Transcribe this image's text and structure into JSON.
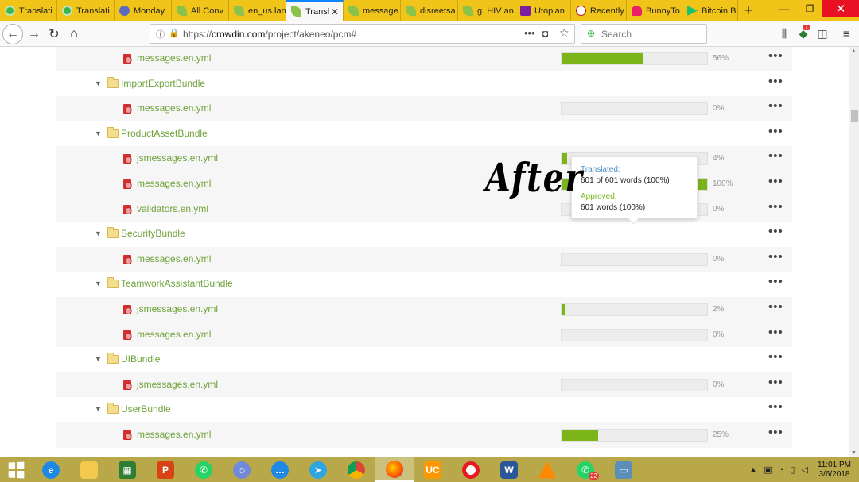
{
  "tabs": [
    {
      "label": "Translati",
      "icon": "crowdin",
      "active": false
    },
    {
      "label": "Translati",
      "icon": "crowdin",
      "active": false
    },
    {
      "label": "Monday",
      "icon": "monday",
      "active": false
    },
    {
      "label": "All Conv",
      "icon": "leaf",
      "active": false
    },
    {
      "label": "en_us.lan",
      "icon": "leaf",
      "active": false
    },
    {
      "label": "Transl",
      "icon": "leaf",
      "active": true
    },
    {
      "label": "message",
      "icon": "leaf",
      "active": false
    },
    {
      "label": "disreetsa",
      "icon": "leaf",
      "active": false
    },
    {
      "label": "g. HIV an",
      "icon": "leaf",
      "active": false
    },
    {
      "label": "Utopian",
      "icon": "utopian",
      "active": false
    },
    {
      "label": "Recently",
      "icon": "recently",
      "active": false
    },
    {
      "label": "BunnyTo",
      "icon": "bunny",
      "active": false
    },
    {
      "label": "Bitcoin B",
      "icon": "bitcoin",
      "active": false
    }
  ],
  "nav": {
    "url_prefix": "https://",
    "url_host": "crowdin.com",
    "url_path": "/project/akeneo/pcm#",
    "search_placeholder": "Search",
    "notification_count": "7"
  },
  "rows": [
    {
      "type": "file",
      "name": "messages.en.yml",
      "progress": 56,
      "pct": "56%"
    },
    {
      "type": "folder",
      "name": "ImportExportBundle"
    },
    {
      "type": "file",
      "name": "messages.en.yml",
      "progress": 0,
      "pct": "0%"
    },
    {
      "type": "folder",
      "name": "ProductAssetBundle"
    },
    {
      "type": "file",
      "name": "jsmessages.en.yml",
      "progress": 4,
      "pct": "4%"
    },
    {
      "type": "file",
      "name": "messages.en.yml",
      "progress": 100,
      "pct": "100%"
    },
    {
      "type": "file",
      "name": "validators.en.yml",
      "progress": 0,
      "pct": "0%"
    },
    {
      "type": "folder",
      "name": "SecurityBundle"
    },
    {
      "type": "file",
      "name": "messages.en.yml",
      "progress": 0,
      "pct": "0%"
    },
    {
      "type": "folder",
      "name": "TeamworkAssistantBundle"
    },
    {
      "type": "file",
      "name": "jsmessages.en.yml",
      "progress": 2,
      "pct": "2%"
    },
    {
      "type": "file",
      "name": "messages.en.yml",
      "progress": 0,
      "pct": "0%"
    },
    {
      "type": "folder",
      "name": "UIBundle"
    },
    {
      "type": "file",
      "name": "jsmessages.en.yml",
      "progress": 0,
      "pct": "0%"
    },
    {
      "type": "folder",
      "name": "UserBundle"
    },
    {
      "type": "file",
      "name": "messages.en.yml",
      "progress": 25,
      "pct": "25%"
    }
  ],
  "tooltip": {
    "translated_label": "Translated:",
    "translated_value": "601 of 601 words (100%)",
    "approved_label": "Approved:",
    "approved_value": "601 words (100%)"
  },
  "overlay_text": "After",
  "taskbar": {
    "apps": [
      {
        "name": "ie",
        "glyph": "e"
      },
      {
        "name": "files",
        "glyph": ""
      },
      {
        "name": "store",
        "glyph": "▦"
      },
      {
        "name": "ppt",
        "glyph": "P"
      },
      {
        "name": "wa",
        "glyph": "✆"
      },
      {
        "name": "discord",
        "glyph": "☺"
      },
      {
        "name": "msg",
        "glyph": "…"
      },
      {
        "name": "tg",
        "glyph": "➤"
      },
      {
        "name": "chrome",
        "glyph": ""
      },
      {
        "name": "ff",
        "glyph": "",
        "active": true
      },
      {
        "name": "uc",
        "glyph": "UC"
      },
      {
        "name": "opera",
        "glyph": ""
      },
      {
        "name": "word",
        "glyph": "W"
      },
      {
        "name": "vlc",
        "glyph": ""
      },
      {
        "name": "wa",
        "glyph": "✆",
        "badge": "22"
      },
      {
        "name": "photos",
        "glyph": "▭"
      }
    ],
    "time": "11:01 PM",
    "date": "3/6/2018"
  },
  "colors": {
    "progress": "#7cb518",
    "link": "#6fa33a",
    "taskbar": "#b8a84a",
    "tabbar": "#f0c419"
  }
}
